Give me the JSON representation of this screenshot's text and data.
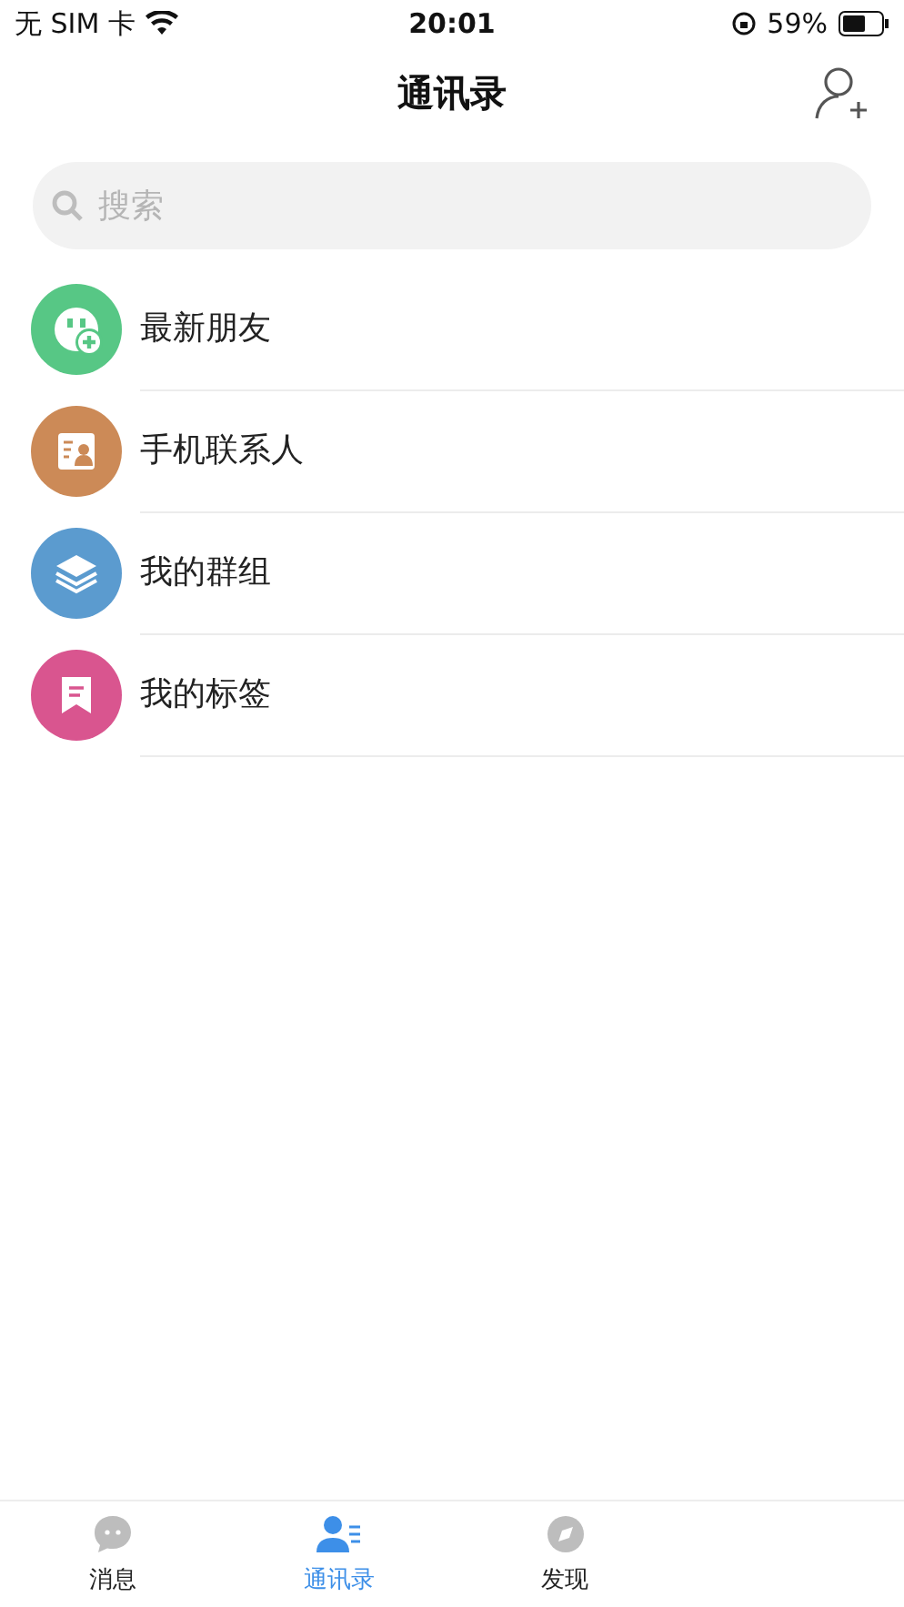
{
  "status_bar": {
    "carrier": "无 SIM 卡",
    "time": "20:01",
    "battery": "59%"
  },
  "nav_bar": {
    "title": "通讯录"
  },
  "search": {
    "placeholder": "搜索"
  },
  "entries": [
    {
      "label": "最新朋友",
      "kind": "new-friends",
      "color": "#57c785"
    },
    {
      "label": "手机联系人",
      "kind": "phone-contacts",
      "color": "#cc8a57"
    },
    {
      "label": "我的群组",
      "kind": "groups",
      "color": "#5b9bcf"
    },
    {
      "label": "我的标签",
      "kind": "tags",
      "color": "#d9558f"
    }
  ],
  "tab_bar": [
    {
      "label": "消息",
      "kind": "chat",
      "selected": false
    },
    {
      "label": "通讯录",
      "kind": "contacts",
      "selected": true
    },
    {
      "label": "发现",
      "kind": "discover",
      "selected": false
    }
  ]
}
